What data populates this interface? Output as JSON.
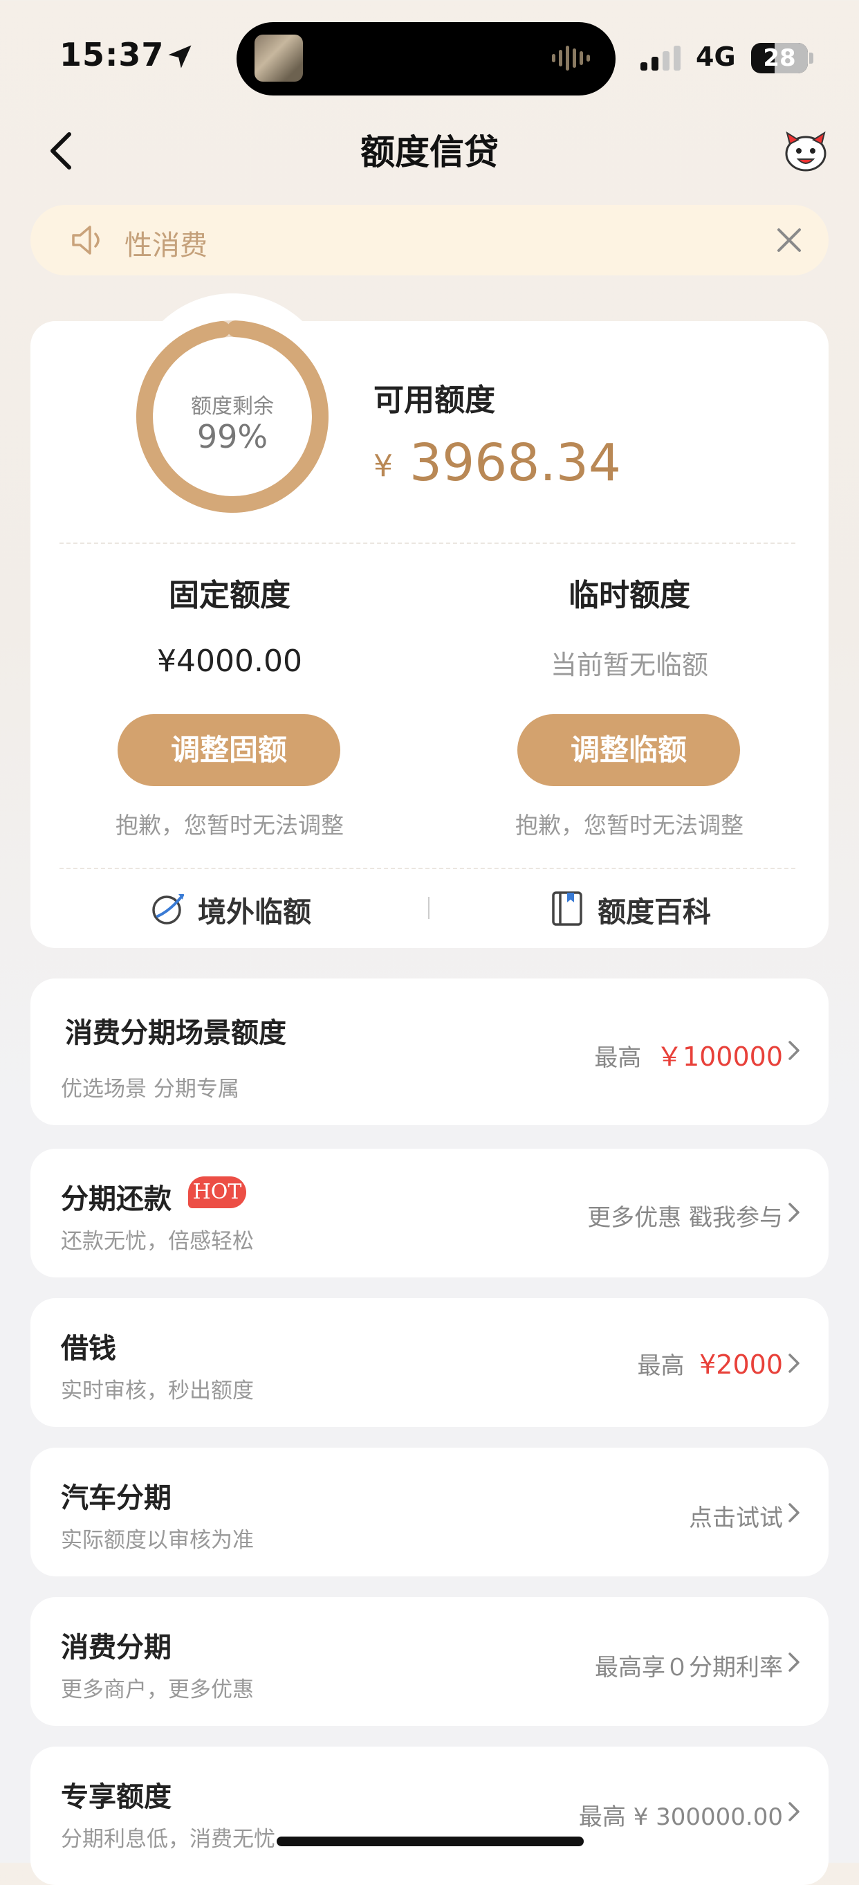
{
  "status_bar": {
    "time": "15:37",
    "network": "4G",
    "battery": "28"
  },
  "nav": {
    "title": "额度信贷"
  },
  "notice": {
    "text": "性消费"
  },
  "credit": {
    "ring_label": "额度剩余",
    "ring_percent_text": "99%",
    "ring_percent": 0.99,
    "available_label": "可用额度",
    "currency": "¥",
    "available_amount": "3968.34",
    "fixed": {
      "title": "固定额度",
      "value": "¥4000.00",
      "button": "调整固额",
      "note": "抱歉，您暂时无法调整"
    },
    "temp": {
      "title": "临时额度",
      "value": "当前暂无临额",
      "button": "调整临额",
      "note": "抱歉，您暂时无法调整"
    },
    "links": {
      "overseas": "境外临额",
      "wiki": "额度百科"
    }
  },
  "items": [
    {
      "title": "消费分期场景额度",
      "sub": "优选场景 分期专属",
      "right_prefix": "最高",
      "right_value": "￥100000"
    },
    {
      "title": "分期还款",
      "badge": "HOT",
      "sub": "还款无忧，倍感轻松",
      "right_text": "更多优惠 戳我参与"
    },
    {
      "title": "借钱",
      "sub": "实时审核，秒出额度",
      "right_prefix": "最高",
      "right_value": "¥2000"
    },
    {
      "title": "汽车分期",
      "sub": "实际额度以审核为准",
      "right_text": "点击试试"
    },
    {
      "title": "消费分期",
      "sub": "更多商户，更多优惠",
      "right_text": "最高享０分期利率"
    },
    {
      "title": "专享额度",
      "sub": "分期利息低，消费无忧",
      "right_text": "最高 ¥ 300000.00"
    }
  ],
  "colors": {
    "accent": "#d3a26e",
    "amount": "#b98855",
    "red": "#e8413a",
    "notice_bg": "#fdf3e2"
  },
  "icons": [
    "location-arrow-icon",
    "audio-wave-icon",
    "signal-icon",
    "battery-icon",
    "back-chevron-icon",
    "mascot-icon",
    "speaker-icon",
    "close-icon",
    "globe-plane-icon",
    "book-icon",
    "chevron-right-icon"
  ]
}
